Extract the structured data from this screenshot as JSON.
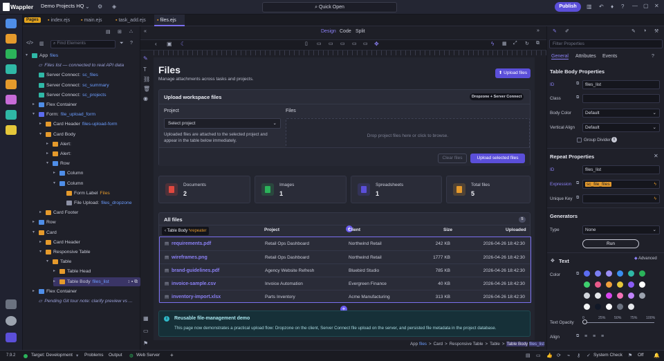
{
  "topbar": {
    "brand": "Wappler",
    "project": "Demo Projects HQ",
    "quick_open": "Quick Open",
    "publish": "Publish"
  },
  "tabs": {
    "pages_badge": "Pages",
    "items": [
      "index.ejs",
      "main.ejs",
      "task_add.ejs",
      "files.ejs"
    ]
  },
  "left": {
    "filter_placeholder": "Find Elements",
    "tree": [
      {
        "label": "App",
        "bind": "files",
        "indent": 0,
        "caret": "v",
        "icon": "#2fb8a6"
      },
      {
        "label": "Files list — connected to real API data",
        "indent": 1,
        "caret": "",
        "icon": "",
        "comment": true
      },
      {
        "label": "Server Connect:",
        "bind": "sc_files",
        "indent": 1,
        "caret": "",
        "icon": "#2fb8a6"
      },
      {
        "label": "Server Connect:",
        "bind": "sc_summary",
        "indent": 1,
        "caret": "",
        "icon": "#2fb8a6"
      },
      {
        "label": "Server Connect:",
        "bind": "sc_projects",
        "indent": 1,
        "caret": "",
        "icon": "#2fb8a6"
      },
      {
        "label": "Flex Container",
        "indent": 1,
        "caret": ">",
        "icon": "#4f8ee8"
      },
      {
        "label": "Form:",
        "bind": "file_upload_form",
        "indent": 1,
        "caret": "v",
        "icon": "#5b6cf0"
      },
      {
        "label": "Card Header",
        "bind": "files-upload-form",
        "indent": 2,
        "caret": ">",
        "icon": "#e59a2c"
      },
      {
        "label": "Card Body",
        "indent": 2,
        "caret": "v",
        "icon": "#e59a2c"
      },
      {
        "label": "Alert:",
        "indent": 3,
        "caret": ">",
        "icon": "#e59a2c"
      },
      {
        "label": "Alert:",
        "indent": 3,
        "caret": ">",
        "icon": "#e59a2c"
      },
      {
        "label": "Row",
        "indent": 3,
        "caret": "v",
        "icon": "#4f8ee8"
      },
      {
        "label": "Column",
        "indent": 4,
        "caret": ">",
        "icon": "#4f8ee8"
      },
      {
        "label": "Column",
        "indent": 4,
        "caret": "v",
        "icon": "#4f8ee8"
      },
      {
        "label": "Form Label",
        "bind": "Files",
        "indent": 5,
        "caret": "",
        "icon": "#e59a2c",
        "orange": true
      },
      {
        "label": "File Upload:",
        "bind": "files_dropzone",
        "indent": 5,
        "caret": "",
        "icon": "#8d91a5"
      },
      {
        "label": "Card Footer",
        "indent": 2,
        "caret": ">",
        "icon": "#e59a2c"
      },
      {
        "label": "Row",
        "indent": 1,
        "caret": ">",
        "icon": "#4f8ee8"
      },
      {
        "label": "Card",
        "indent": 1,
        "caret": "v",
        "icon": "#e59a2c"
      },
      {
        "label": "Card Header",
        "indent": 2,
        "caret": ">",
        "icon": "#e59a2c"
      },
      {
        "label": "Responsive Table",
        "indent": 2,
        "caret": "v",
        "icon": "#e59a2c"
      },
      {
        "label": "Table",
        "indent": 3,
        "caret": "v",
        "icon": "#e59a2c"
      },
      {
        "label": "Table Head",
        "indent": 4,
        "caret": ">",
        "icon": "#e59a2c"
      },
      {
        "label": "Table Body",
        "bind": "files_list",
        "indent": 4,
        "caret": ">",
        "icon": "#e59a2c",
        "selected": true
      },
      {
        "label": "Flex Container",
        "indent": 1,
        "caret": ">",
        "icon": "#4f8ee8"
      },
      {
        "label": "Pending Git tour note: clarify preview vs ...",
        "indent": 1,
        "caret": "",
        "icon": "",
        "comment": true
      }
    ]
  },
  "toolbar": {
    "design": "Design",
    "code": "Code",
    "split": "Split"
  },
  "page": {
    "title": "Files",
    "subtitle": "Manage attachments across tasks and projects.",
    "upload_btn": "Upload files",
    "upload_card": {
      "title": "Upload workspace files",
      "badge": "Dropzone + Server Connect",
      "project_label": "Project",
      "files_label": "Files",
      "select": "Select project",
      "hint": "Uploaded files are attached to the selected project and appear in the table below immediately.",
      "drop": "Drop project files here or click to browse.",
      "clear": "Clear files",
      "upload": "Upload selected files"
    },
    "stats": [
      {
        "label": "Documents",
        "value": "2",
        "color": "#e0483f"
      },
      {
        "label": "Images",
        "value": "1",
        "color": "#2bb35a"
      },
      {
        "label": "Spreadsheets",
        "value": "1",
        "color": "#5b4fd9"
      },
      {
        "label": "Total files",
        "value": "5",
        "color": "#e59a2c"
      }
    ],
    "all_files": {
      "title": "All files",
      "count": "5",
      "crumb": "Table Body",
      "crumb_tag": "repeater",
      "headers": [
        "Project",
        "Client",
        "Size",
        "Uploaded"
      ],
      "rows": [
        {
          "name": "requirements.pdf",
          "project": "Retail Ops Dashboard",
          "client": "Northwind Retail",
          "size": "242 KB",
          "uploaded": "2026-04-26 18:42:30"
        },
        {
          "name": "wireframes.png",
          "project": "Retail Ops Dashboard",
          "client": "Northwind Retail",
          "size": "1777 KB",
          "uploaded": "2026-04-26 18:42:30"
        },
        {
          "name": "brand-guidelines.pdf",
          "project": "Agency Website Refresh",
          "client": "Bluebird Studio",
          "size": "785 KB",
          "uploaded": "2026-04-26 18:42:30"
        },
        {
          "name": "invoice-sample.csv",
          "project": "Invoice Automation",
          "client": "Evergreen Finance",
          "size": "40 KB",
          "uploaded": "2026-04-26 18:42:30"
        },
        {
          "name": "inventory-import.xlsx",
          "project": "Parts Inventory",
          "client": "Acme Manufacturing",
          "size": "313 KB",
          "uploaded": "2026-04-26 18:42:30"
        }
      ]
    },
    "info": {
      "title": "Reusable file-management demo",
      "text": "This page now demonstrates a practical upload flow: Dropzone on the client, Server Connect file upload on the server, and persisted file metadata in the project database."
    }
  },
  "breadcrumb": {
    "items": [
      "App",
      "files",
      ">",
      "Card",
      ">",
      "Responsive Table",
      ">",
      "Table",
      ">",
      "Table Body",
      "files_list"
    ]
  },
  "right": {
    "filter_placeholder": "Filter Properties",
    "tabs": [
      "General",
      "Attributes",
      "Events"
    ],
    "tbp_title": "Table Body Properties",
    "id_label": "ID",
    "id_value": "files_list",
    "class_label": "Class",
    "class_value": "",
    "body_color_label": "Body Color",
    "body_color": "Default",
    "valign_label": "Vertical Align",
    "valign": "Default",
    "group_divider": "Group Divider",
    "repeat_title": "Repeat Properties",
    "rid_label": "ID",
    "rid_value": "files_list",
    "expr_label": "Expression",
    "expr_value": "sc_file_files",
    "ukey_label": "Unique Key",
    "ukey_value": "",
    "gen_title": "Generators",
    "type_label": "Type",
    "type_value": "None",
    "run": "Run",
    "text_title": "Text",
    "advanced": "Advanced",
    "color_label": "Color",
    "swatches": [
      "#5b6cf0",
      "#7b7ff2",
      "#9b8ef5",
      "#3a8ef0",
      "#2fb8a6",
      "#2bb35a",
      "#3ecf6e",
      "#e85a8a",
      "#f0a03c",
      "#e5c73a",
      "#8b5cf6",
      "#ffffff",
      "#d1d5db",
      "#e5e7eb",
      "#d946ef",
      "#f472b6",
      "#c084fc",
      "#9ca3af",
      "#f3f4f6",
      "#111827",
      "#ffffff",
      "#6b7280",
      "#e5e7eb"
    ],
    "opacity_label": "Text Opacity",
    "opacity_ticks": [
      "0",
      "25%",
      "50%",
      "75%",
      "100%"
    ],
    "align_label": "Align"
  },
  "status": {
    "version": "7.9.2",
    "target": "Target: Development",
    "problems": "Problems",
    "output": "Output",
    "web_server": "Web Server",
    "system_check": "System Check",
    "off": "Off"
  }
}
